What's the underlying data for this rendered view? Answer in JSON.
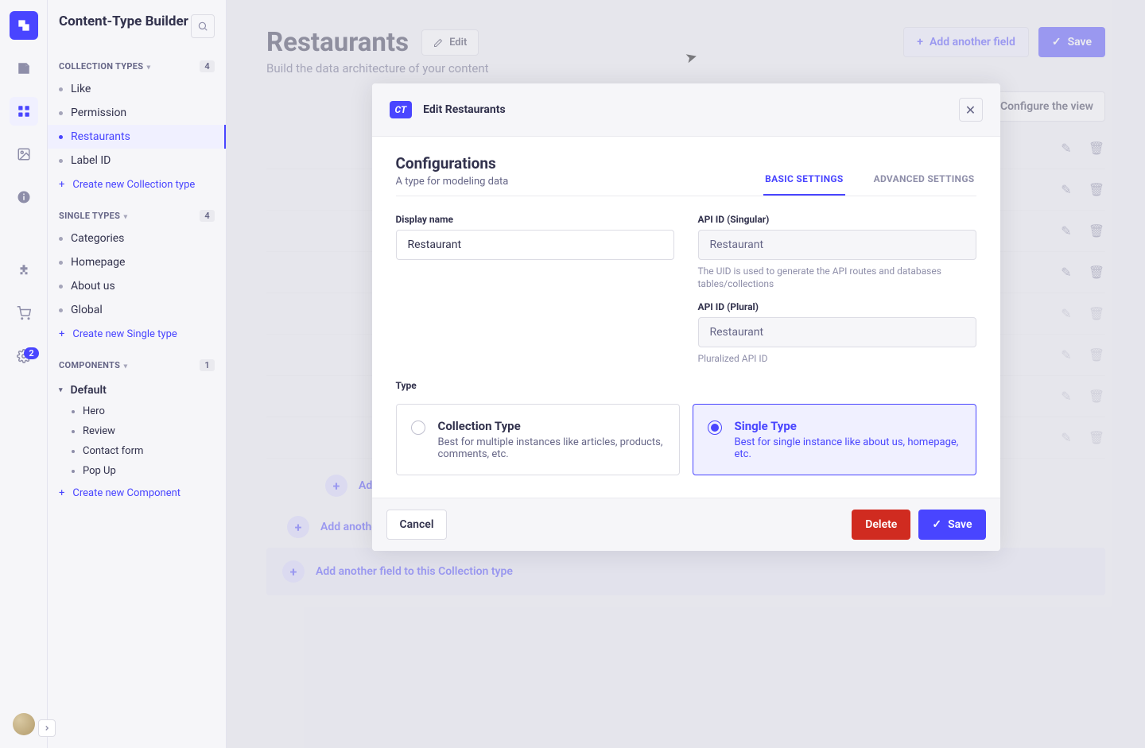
{
  "nav": {
    "settings_badge": "2"
  },
  "sidebar": {
    "title": "Content-Type Builder",
    "groups": {
      "collection": {
        "label": "Collection Types",
        "count": "4",
        "create": "Create new Collection type"
      },
      "single": {
        "label": "Single Types",
        "count": "4",
        "create": "Create new Single type"
      },
      "components": {
        "label": "Components",
        "count": "1",
        "create": "Create new Component"
      }
    },
    "collection_items": [
      "Like",
      "Permission",
      "Restaurants",
      "Label ID"
    ],
    "single_items": [
      "Categories",
      "Homepage",
      "About us",
      "Global"
    ],
    "component_group": "Default",
    "component_items": [
      "Hero",
      "Review",
      "Contact form",
      "Pop Up"
    ]
  },
  "page": {
    "title": "Restaurants",
    "edit": "Edit",
    "subtitle": "Build the data architecture of your content",
    "add_field": "Add another field",
    "save": "Save",
    "configure": "Configure the view",
    "add_component_field": "Add another field to this component",
    "add_collection_field": "Add another field to this Collection type"
  },
  "modal": {
    "badge": "CT",
    "title": "Edit Restaurants",
    "cfg_title": "Configurations",
    "cfg_sub": "A type for modeling data",
    "tab_basic": "Basic Settings",
    "tab_advanced": "Advanced Settings",
    "display_label": "Display name",
    "display_value": "Restaurant",
    "api_sing_label": "API ID (Singular)",
    "api_sing_value": "Restaurant",
    "api_sing_help": "The UID is used to generate the API routes and databases tables/collections",
    "api_plur_label": "API ID (Plural)",
    "api_plur_value": "Restaurant",
    "api_plur_help": "Pluralized API ID",
    "type_label": "Type",
    "type_collection_title": "Collection Type",
    "type_collection_desc": "Best for multiple instances like articles, products, comments, etc.",
    "type_single_title": "Single Type",
    "type_single_desc": "Best for single instance like about us, homepage, etc.",
    "cancel": "Cancel",
    "delete": "Delete",
    "save": "Save"
  }
}
